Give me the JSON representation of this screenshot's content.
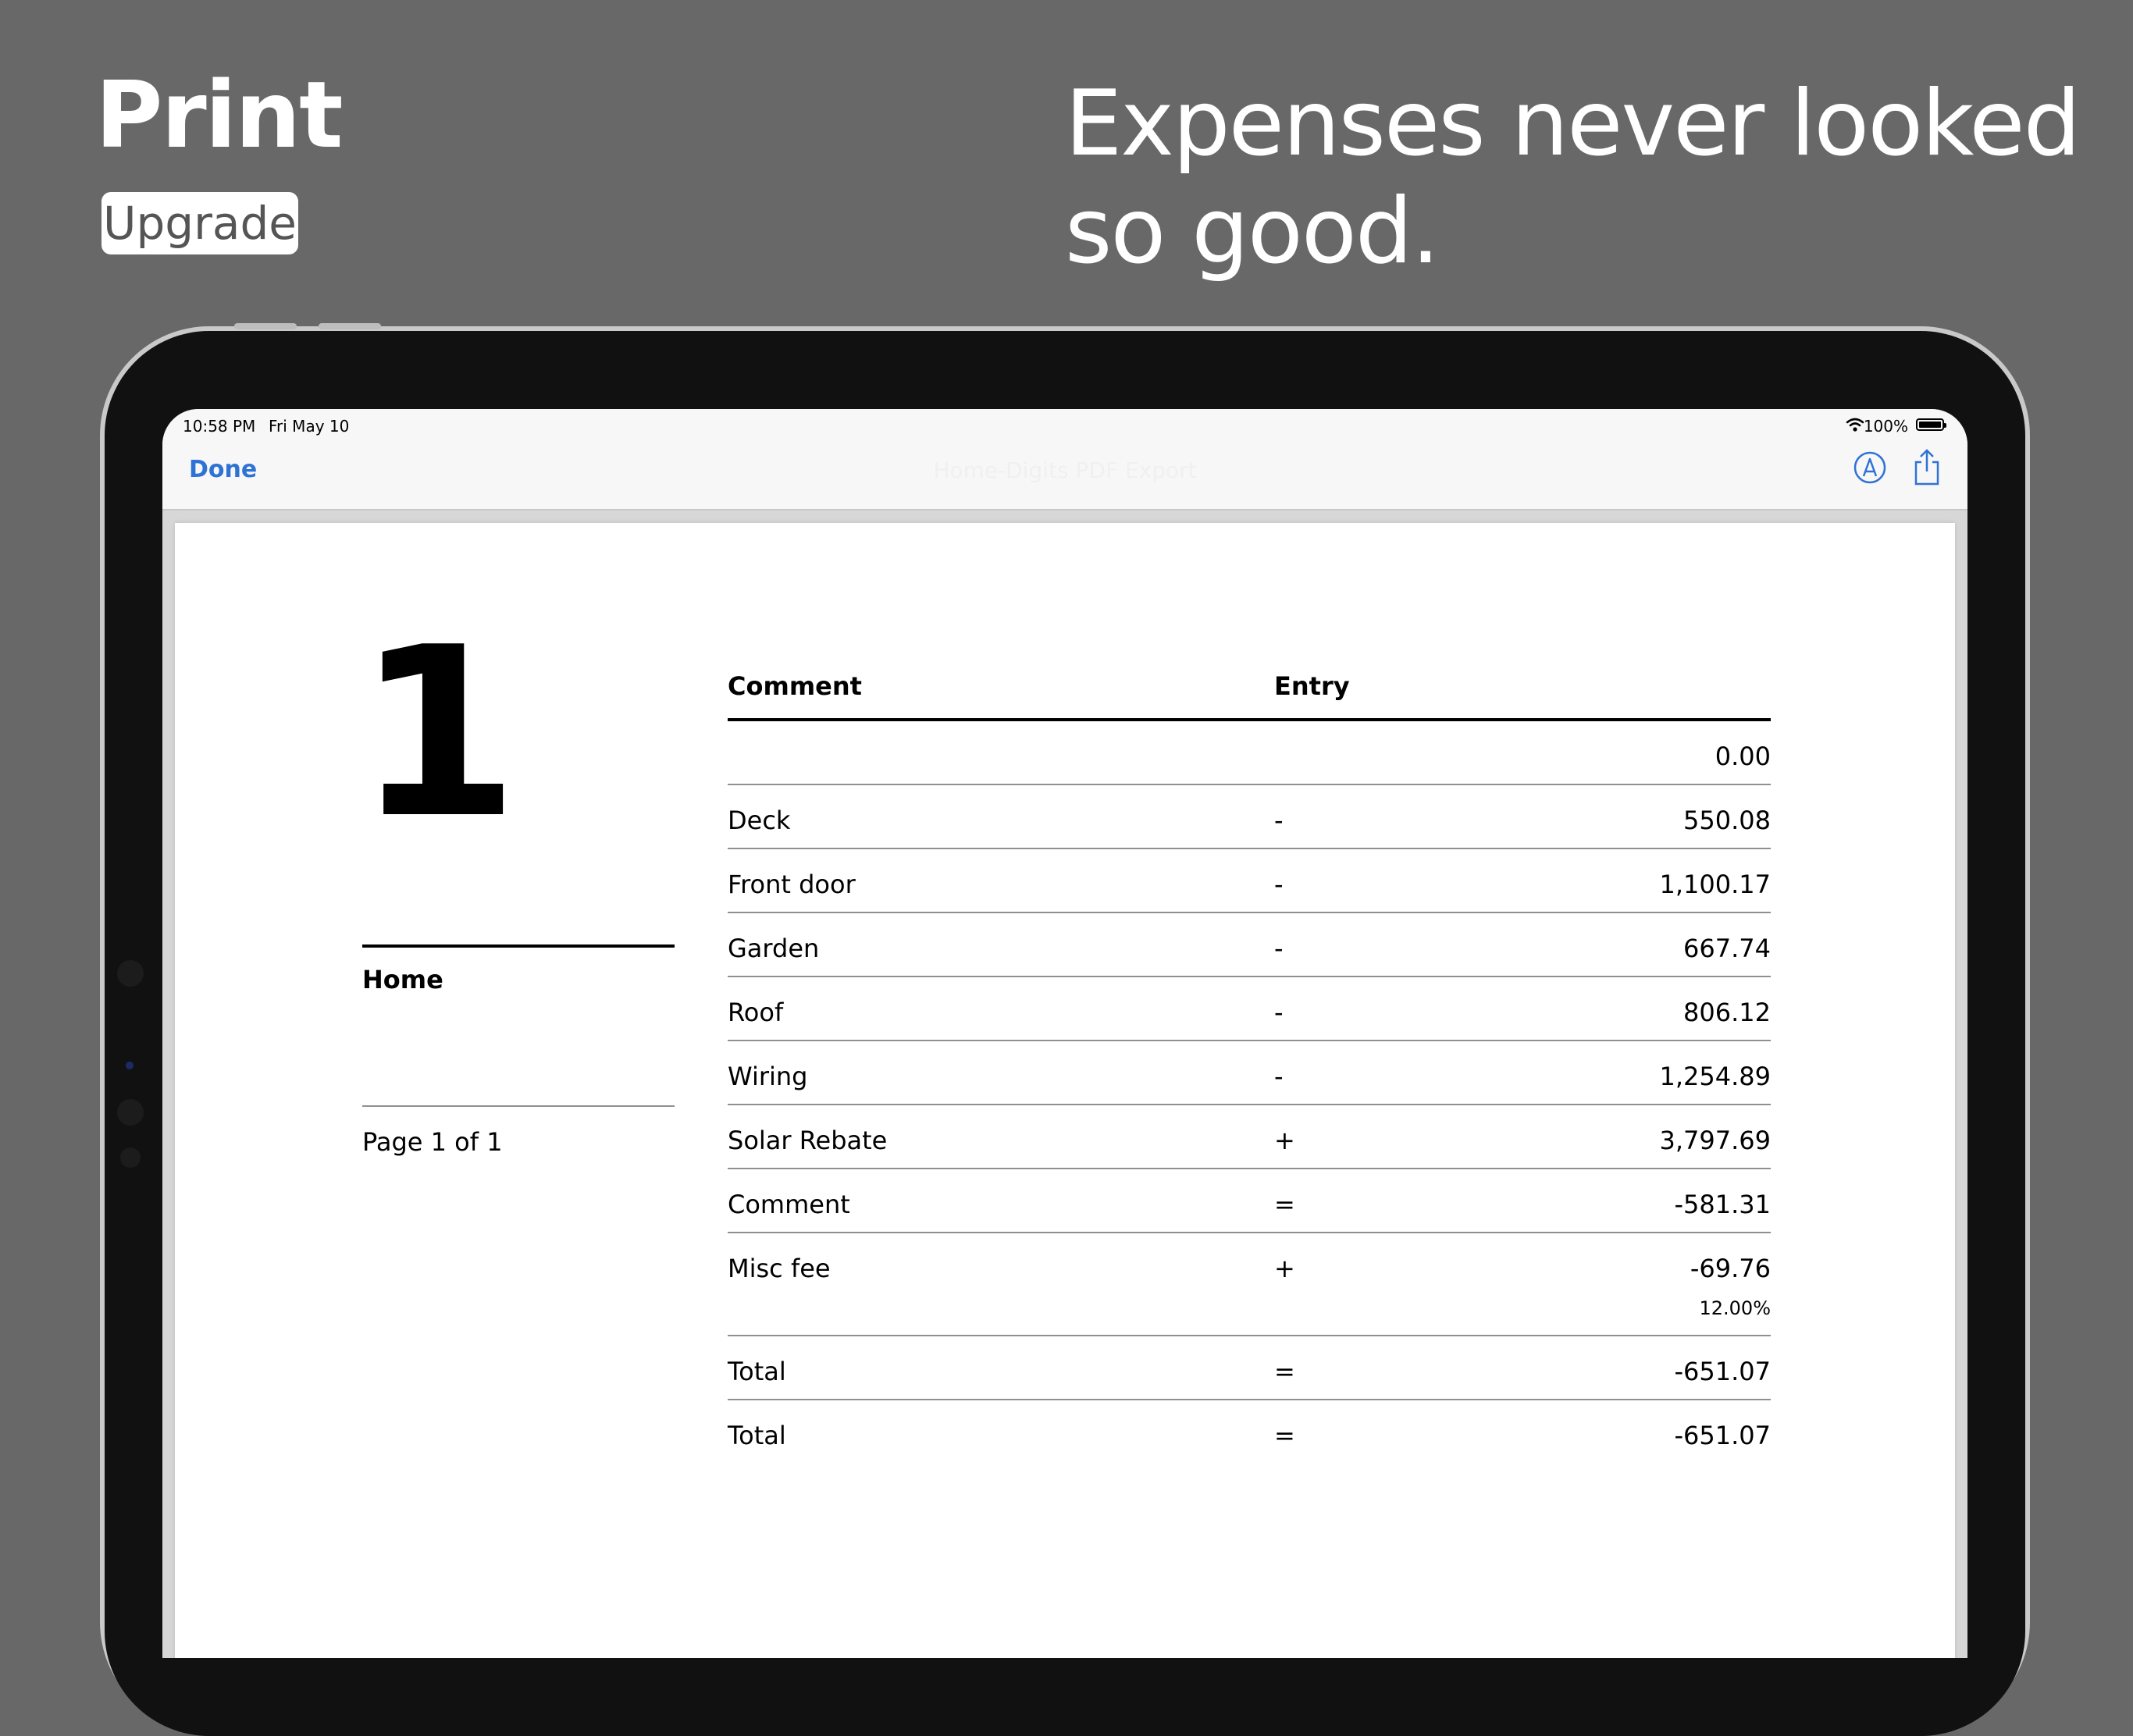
{
  "promo": {
    "title": "Print",
    "badge": "Upgrade",
    "headline": "Expenses never looked so good."
  },
  "status_bar": {
    "time": "10:58 PM",
    "date": "Fri May 10",
    "battery": "100%"
  },
  "nav": {
    "done_label": "Done",
    "title": "Home-Digits PDF Export"
  },
  "document": {
    "number": "1",
    "section_name": "Home",
    "page_indicator": "Page 1 of 1",
    "columns": {
      "comment": "Comment",
      "entry": "Entry"
    },
    "rows": [
      {
        "comment": "",
        "op": "",
        "amount": "0.00",
        "sub": ""
      },
      {
        "comment": "Deck",
        "op": "-",
        "amount": "550.08",
        "sub": ""
      },
      {
        "comment": "Front door",
        "op": "-",
        "amount": "1,100.17",
        "sub": ""
      },
      {
        "comment": "Garden",
        "op": "-",
        "amount": "667.74",
        "sub": ""
      },
      {
        "comment": "Roof",
        "op": "-",
        "amount": "806.12",
        "sub": ""
      },
      {
        "comment": "Wiring",
        "op": "-",
        "amount": "1,254.89",
        "sub": ""
      },
      {
        "comment": "Solar Rebate",
        "op": "+",
        "amount": "3,797.69",
        "sub": ""
      },
      {
        "comment": "Comment",
        "op": "=",
        "amount": "-581.31",
        "sub": ""
      },
      {
        "comment": "Misc fee",
        "op": "+",
        "amount": "-69.76",
        "sub": "12.00%"
      },
      {
        "comment": "Total",
        "op": "=",
        "amount": "-651.07",
        "sub": ""
      },
      {
        "comment": "Total",
        "op": "=",
        "amount": "-651.07",
        "sub": ""
      }
    ]
  },
  "colors": {
    "background": "#686868",
    "accent": "#2f72d6"
  }
}
